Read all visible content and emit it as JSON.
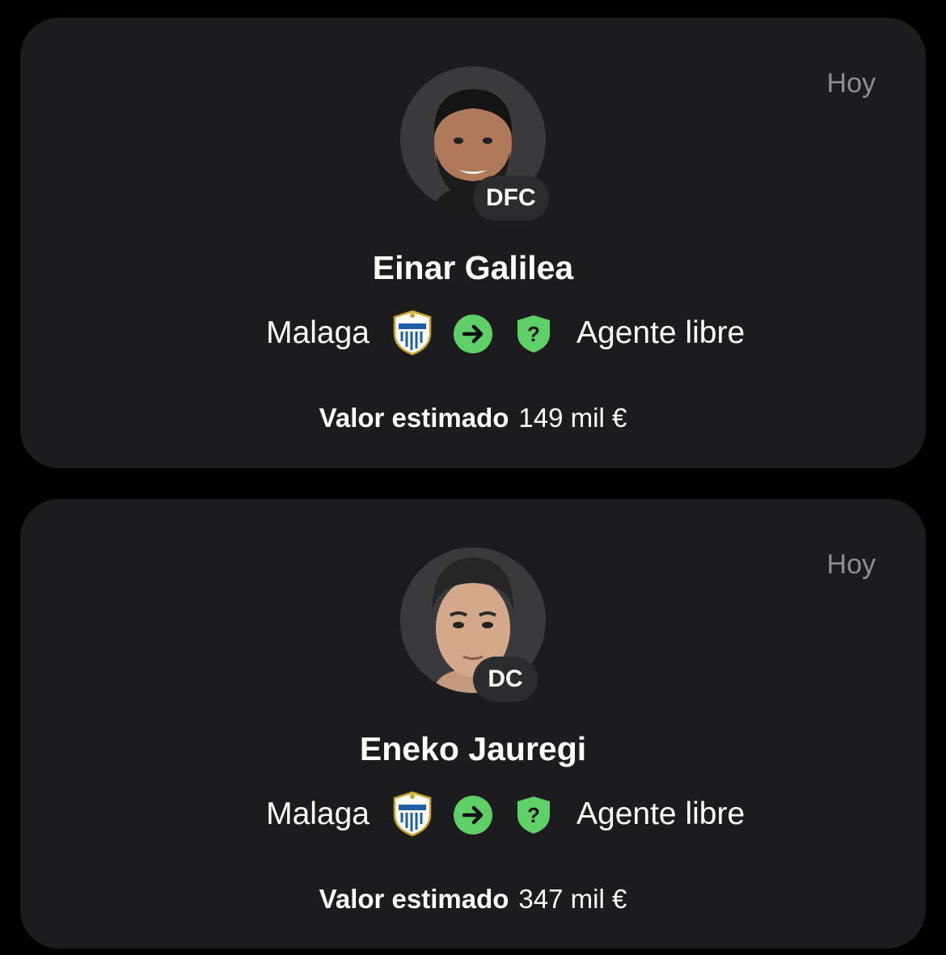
{
  "colors": {
    "background": "#000000",
    "card": "#1c1c1e",
    "date_text": "#8e8e93",
    "badge_bg": "#2c2c2e",
    "accent_green": "#5fd068"
  },
  "icons": {
    "from_crest": "malaga-crest-icon",
    "transfer": "arrow-right-circle-icon",
    "to_crest": "unknown-shield-icon"
  },
  "transfers": [
    {
      "date": "Hoy",
      "position": "DFC",
      "name": "Einar Galilea",
      "from_team": "Malaga",
      "to_team": "Agente libre",
      "shield_symbol": "?",
      "value_label": "Valor estimado",
      "value": "149 mil €"
    },
    {
      "date": "Hoy",
      "position": "DC",
      "name": "Eneko Jauregi",
      "from_team": "Malaga",
      "to_team": "Agente libre",
      "shield_symbol": "?",
      "value_label": "Valor estimado",
      "value": "347 mil €"
    }
  ]
}
